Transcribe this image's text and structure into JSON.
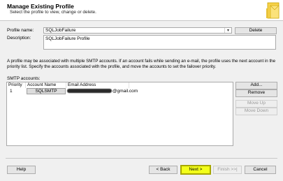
{
  "header": {
    "title": "Manage Existing Profile",
    "subtitle": "Select the profile to view, change or delete."
  },
  "profile": {
    "name_label": "Profile name:",
    "name_value": "SQLJobFailure",
    "delete_label": "Delete",
    "description_label": "Description:",
    "description_value": "SQLJobFailure Profile"
  },
  "info_text": "A profile may be associated with multiple SMTP accounts. If an account fails while sending an e-mail, the profile uses the next account in the priority list. Specify the accounts associated with the profile, and move the accounts to set the failover priority.",
  "smtp": {
    "label": "SMTP accounts:",
    "columns": [
      "Priority",
      "Account Name",
      "Email Address"
    ],
    "rows": [
      {
        "priority": "1",
        "account": "SQLSMTP",
        "email_suffix": "@gmail.com"
      }
    ],
    "buttons": {
      "add": "Add...",
      "remove": "Remove",
      "move_up": "Move Up",
      "move_down": "Move Down"
    }
  },
  "footer": {
    "help": "Help",
    "back": "< Back",
    "next": "Next >",
    "finish": "Finish >>|",
    "cancel": "Cancel"
  },
  "colors": {
    "next_highlight": "#f3ff1a",
    "header_bg": "#ffffff",
    "window_bg": "#f0f0f0"
  }
}
